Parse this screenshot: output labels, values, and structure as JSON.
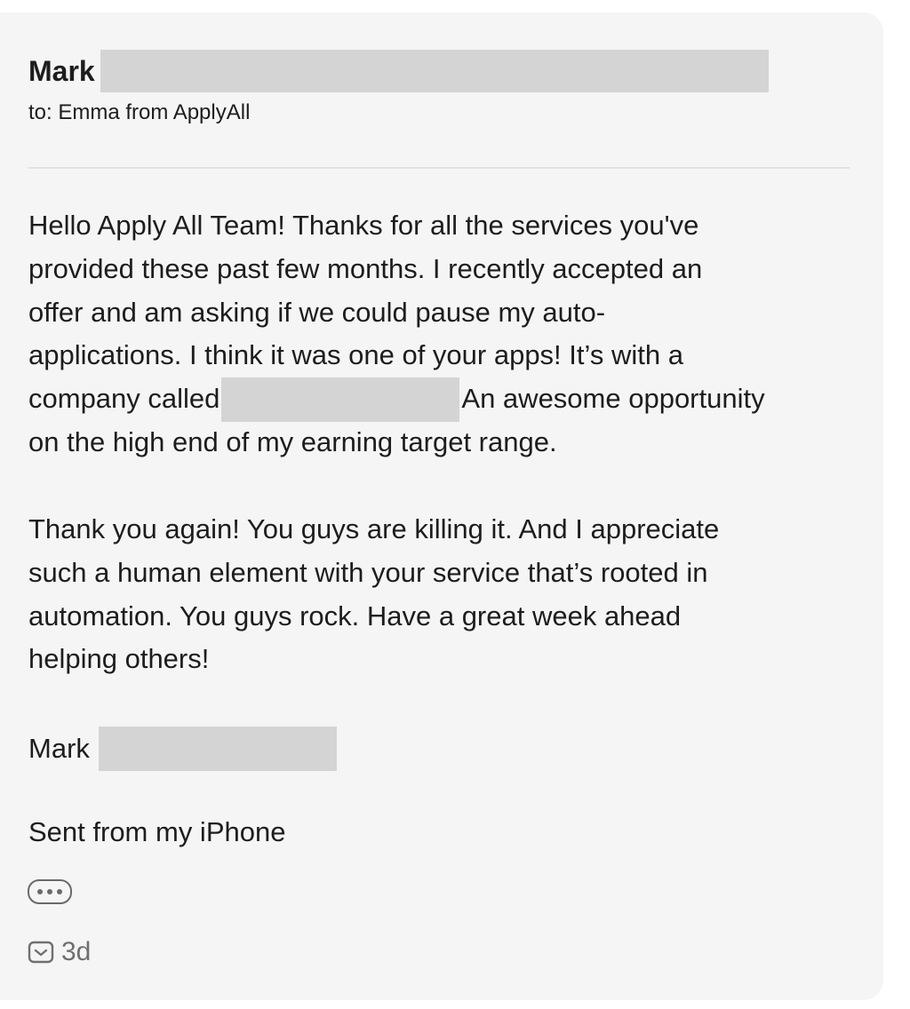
{
  "message": {
    "sender_name": "Mark",
    "recipient_line": "to: Emma from ApplyAll",
    "paragraph1": {
      "line1": "Hello Apply All Team! Thanks for all the services you've",
      "line2": "provided these past few months. I recently accepted an",
      "line3": "offer and am asking if we could pause my auto-",
      "line4": "applications. I think it was one of your apps! It’s with a",
      "line5_before": "company called",
      "line5_after": "An awesome opportunity",
      "line6": "on the high end of my earning target range."
    },
    "paragraph2": {
      "line1": "Thank you again! You guys are killing it. And I appreciate",
      "line2": "such a human element with your service that’s rooted in",
      "line3": "automation. You guys rock. Have a great week ahead",
      "line4": "helping others!"
    },
    "signature_name": "Mark",
    "sent_from": "Sent from my iPhone",
    "timestamp": "3d"
  },
  "icons": {
    "more": "ellipsis-icon",
    "mail": "envelope-icon"
  },
  "colors": {
    "card_background": "#f5f5f5",
    "redaction": "#d4d4d4",
    "text": "#1d1d1d",
    "muted": "#6f6f6f"
  }
}
